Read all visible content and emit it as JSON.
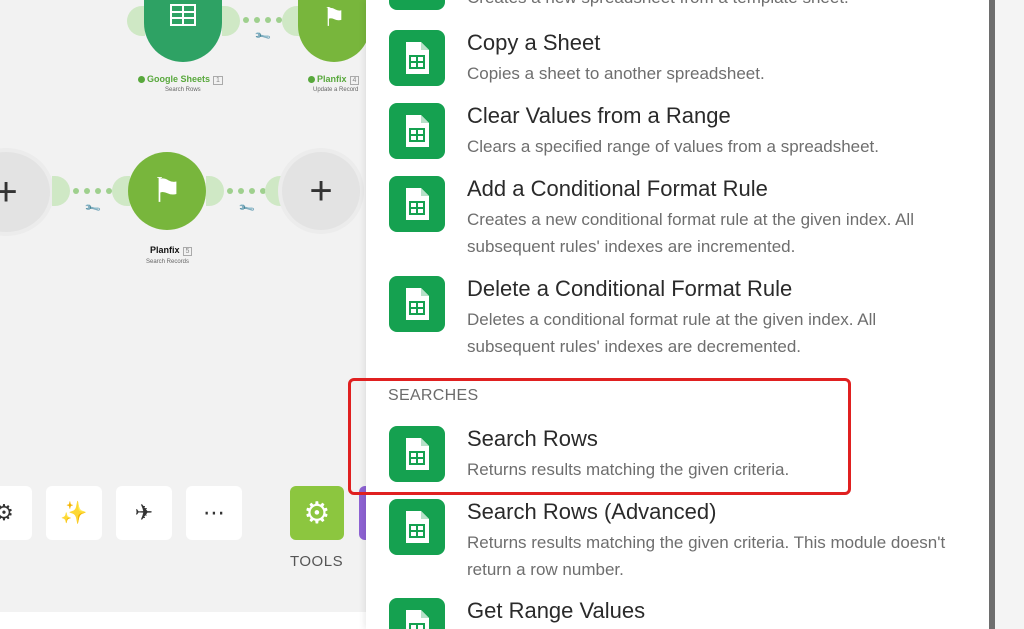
{
  "canvas": {
    "modules": [
      {
        "name": "Google Sheets",
        "badge": "1",
        "subtitle": "Search Rows"
      },
      {
        "name": "Planfix",
        "badge": "4",
        "subtitle": "Update a Record"
      },
      {
        "name": "Planfix",
        "badge": "5",
        "subtitle": "Search Records"
      }
    ],
    "tools_label": "TOOLS"
  },
  "panel": {
    "top_partial_desc": "Creates a new spreadsheet from a template sheet.",
    "items": [
      {
        "title": "Copy a Sheet",
        "desc": "Copies a sheet to another spreadsheet."
      },
      {
        "title": "Clear Values from a Range",
        "desc": "Clears a specified range of values from a spreadsheet."
      },
      {
        "title": "Add a Conditional Format Rule",
        "desc": "Creates a new conditional format rule at the given index. All subsequent rules' indexes are incremented."
      },
      {
        "title": "Delete a Conditional Format Rule",
        "desc": "Deletes a conditional format rule at the given index. All subsequent rules' indexes are decremented."
      }
    ],
    "section_searches": "SEARCHES",
    "search_items": [
      {
        "title": "Search Rows",
        "desc": "Returns results matching the given criteria."
      },
      {
        "title": "Search Rows (Advanced)",
        "desc": "Returns results matching the given criteria. This module doesn't return a row number."
      },
      {
        "title": "Get Range Values",
        "desc": ""
      }
    ]
  },
  "colors": {
    "sheets_green": "#15a150",
    "planfix_green": "#78b63c",
    "highlight": "#e02020",
    "tools": "#8cc63f"
  }
}
